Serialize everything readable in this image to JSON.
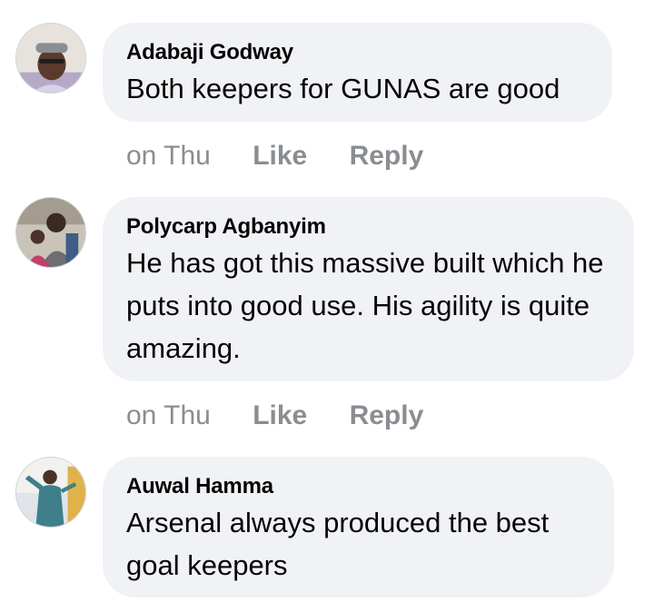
{
  "comments": [
    {
      "author": "Adabaji Godway",
      "text": "Both keepers for GUNAS are good",
      "time": "on Thu",
      "like_label": "Like",
      "reply_label": "Reply"
    },
    {
      "author": "Polycarp Agbanyim",
      "text": "He has got this massive built which he puts into good use. His agility is quite amazing.",
      "time": "on Thu",
      "like_label": "Like",
      "reply_label": "Reply"
    },
    {
      "author": "Auwal Hamma",
      "text": "Arsenal always produced the best goal keepers"
    }
  ],
  "colors": {
    "bubble": "#f0f2f5",
    "text": "#050505",
    "meta": "#8a8d91"
  }
}
